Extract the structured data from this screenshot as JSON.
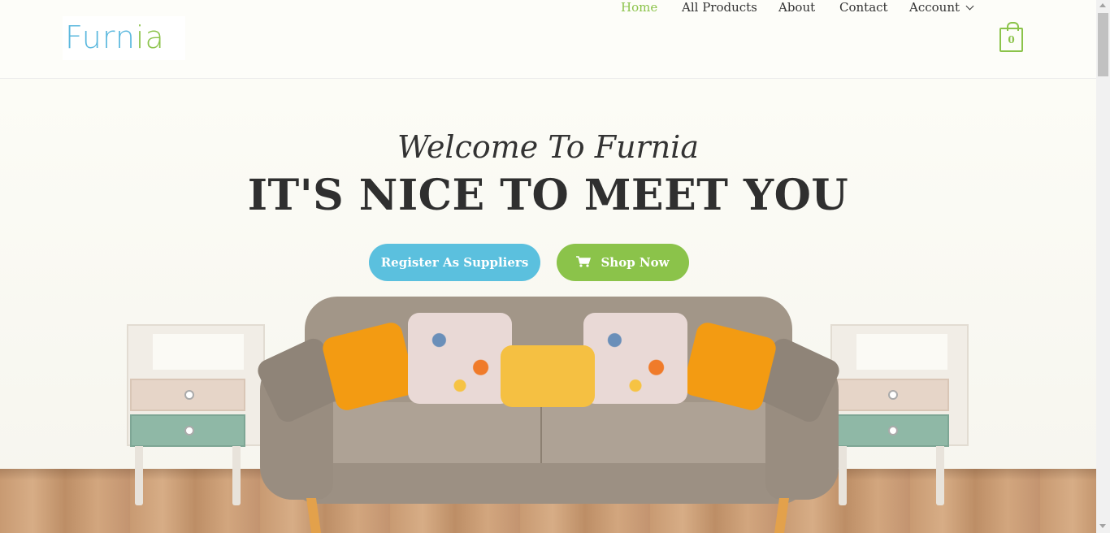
{
  "brand": {
    "logo_text_main": "Furn",
    "logo_text_accent": "ia"
  },
  "nav": {
    "items": [
      {
        "label": "Home",
        "active": true
      },
      {
        "label": "All Products"
      },
      {
        "label": "About"
      },
      {
        "label": "Contact"
      },
      {
        "label": "Account"
      }
    ],
    "cart_count": "0"
  },
  "hero": {
    "welcome": "Welcome To Furnia",
    "headline": "IT'S NICE TO MEET YOU",
    "register_button": "Register As Suppliers",
    "shop_button": "Shop Now"
  },
  "colors": {
    "accent_green": "#8bc34a",
    "accent_blue": "#5bc0de",
    "text_dark": "#333333"
  },
  "icons": {
    "cart": "shopping-bag-icon",
    "shop": "shopping-cart-icon",
    "account_dropdown": "chevron-down-icon"
  }
}
